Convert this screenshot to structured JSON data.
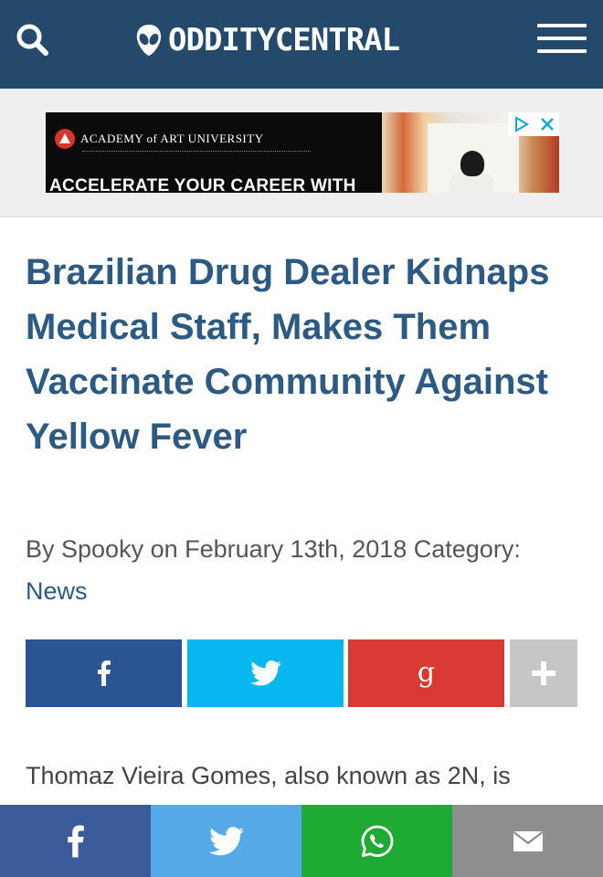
{
  "header": {
    "logo_text": "ODDITYCENTRAL",
    "icons": {
      "search": "search-icon",
      "logo": "alien-head-icon",
      "menu": "hamburger-menu-icon"
    },
    "background": "#24496b"
  },
  "ad": {
    "brand": "ACADEMY of ART UNIVERSITY",
    "headline": "ACCELERATE YOUR CAREER WITH",
    "icons": {
      "adchoices": "adchoices-icon",
      "close": "close-icon"
    }
  },
  "article": {
    "title": "Brazilian Drug Dealer Kidnaps Medical Staff, Makes Them Vaccinate Community Against Yellow Fever",
    "meta_text": "By Spooky on February 13th, 2018 Category:",
    "category": "News",
    "body_start": "Thomaz Vieira Gomes, also known as 2N, is",
    "title_color": "#2d5a82"
  },
  "share_buttons": [
    {
      "network": "facebook",
      "icon": "facebook-icon",
      "color": "#2b5495"
    },
    {
      "network": "twitter",
      "icon": "twitter-icon",
      "color": "#06b8ef"
    },
    {
      "network": "google-plus",
      "icon": "google-plus-icon",
      "color": "#d83a33"
    },
    {
      "network": "more",
      "icon": "plus-icon",
      "color": "#c6c6c6"
    }
  ],
  "bottom_bar": [
    {
      "network": "facebook",
      "icon": "facebook-icon",
      "color": "#3b5b9a"
    },
    {
      "network": "twitter",
      "icon": "twitter-icon",
      "color": "#54a9e6"
    },
    {
      "network": "whatsapp",
      "icon": "whatsapp-icon",
      "color": "#1eaa33"
    },
    {
      "network": "email",
      "icon": "mail-icon",
      "color": "#8e8e8e"
    }
  ]
}
